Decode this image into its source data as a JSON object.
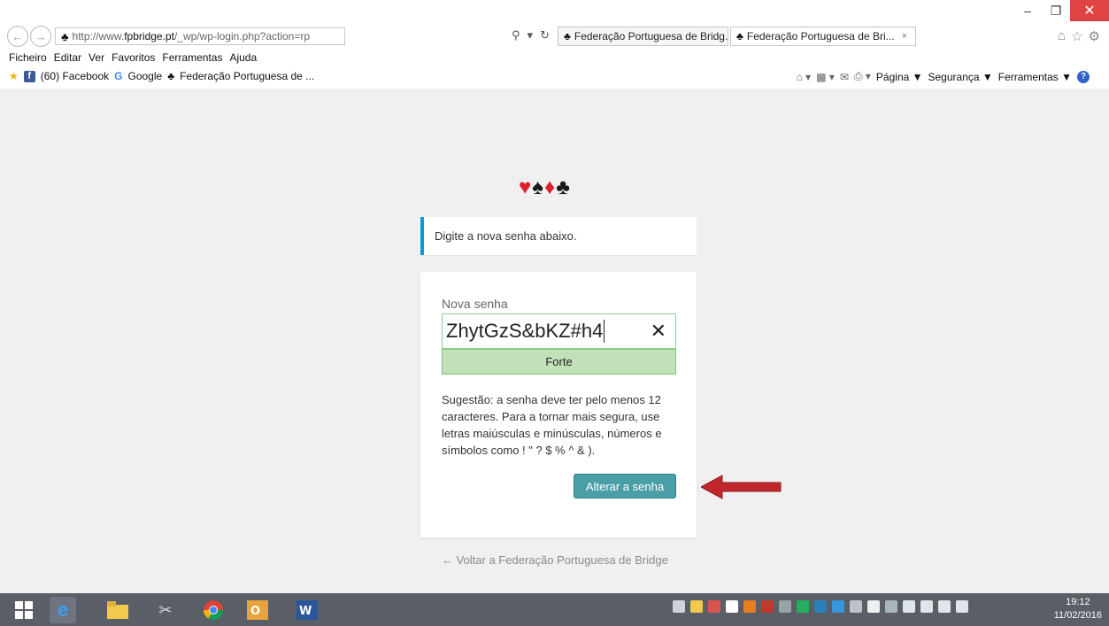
{
  "browser": {
    "window_controls": {
      "minimize": "–",
      "restore": "❐",
      "close": "✕"
    },
    "address": {
      "prefix": "http://www.",
      "domain": "fpbridge.pt",
      "path": "/_wp/wp-login.php?action=rp"
    },
    "tabs": [
      {
        "label": "Federação Portuguesa de Bridg..."
      },
      {
        "label": "Federação Portuguesa de Bri...",
        "close": "×"
      }
    ],
    "menu": [
      "Ficheiro",
      "Editar",
      "Ver",
      "Favoritos",
      "Ferramentas",
      "Ajuda"
    ],
    "favorites": {
      "facebook": "(60) Facebook",
      "google": "Google",
      "fpb": "Federação Portuguesa de ..."
    },
    "command_bar": {
      "page": "Página ▼",
      "security": "Segurança ▼",
      "tools": "Ferramentas ▼"
    }
  },
  "page": {
    "suits": {
      "heart": "♥",
      "spade": "♠",
      "diamond": "♦",
      "club": "♣"
    },
    "notice": "Digite a nova senha abaixo.",
    "form": {
      "label": "Nova senha",
      "password_value": "ZhytGzS&bKZ#h4",
      "clear_symbol": "✕",
      "strength": "Forte",
      "hint": "Sugestão: a senha deve ter pelo menos 12 caracteres. Para a tornar mais segura, use letras maiúsculas e minúsculas, números e símbolos como ! \" ? $ % ^ & ).",
      "submit_label": "Alterar a senha"
    },
    "back_link": "← Voltar a Federação Portuguesa de Bridge"
  },
  "taskbar": {
    "time": "19:12",
    "date": "11/02/2016"
  },
  "colors": {
    "accent_notice": "#00a0d2",
    "button": "#4a9fa6",
    "strength_bg": "#c1e1b9",
    "arrow": "#c0282d"
  }
}
